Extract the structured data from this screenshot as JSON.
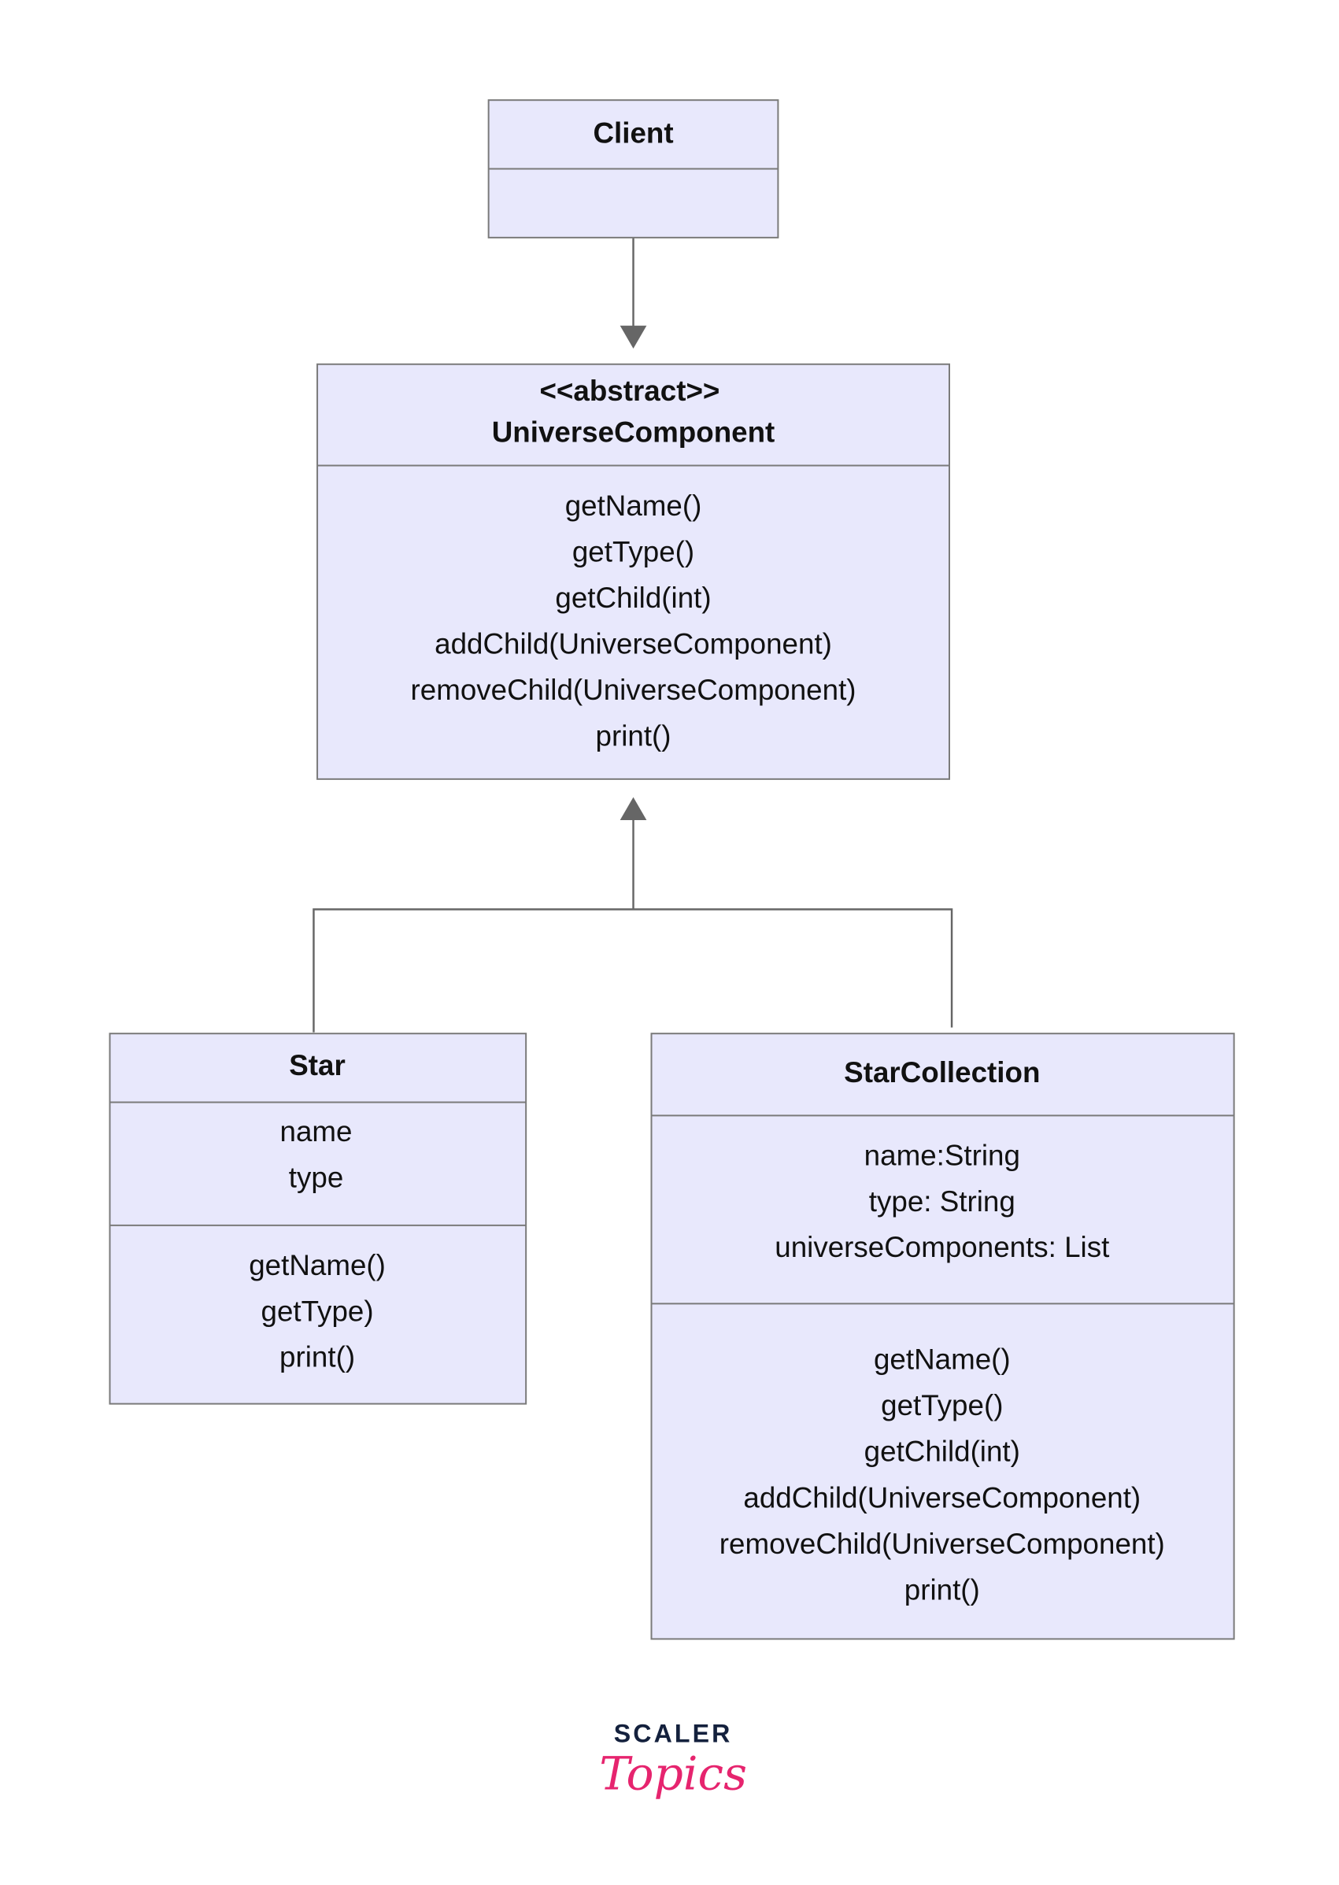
{
  "colors": {
    "box_fill": "#e8e8fc",
    "box_border": "#7a7a7a",
    "edge": "#666666",
    "logo_dark": "#14213d",
    "logo_pink": "#e6246e"
  },
  "client": {
    "title": "Client"
  },
  "universe_component": {
    "stereotype": "<<abstract>>",
    "title": "UniverseComponent",
    "methods": [
      "getName()",
      "getType()",
      "getChild(int)",
      "addChild(UniverseComponent)",
      "removeChild(UniverseComponent)",
      "print()"
    ]
  },
  "star": {
    "title": "Star",
    "attributes": [
      "name",
      "type"
    ],
    "methods": [
      "getName()",
      "getType)",
      "print()"
    ]
  },
  "star_collection": {
    "title": "StarCollection",
    "attributes": [
      "name:String",
      "type: String",
      "universeComponents: List"
    ],
    "methods": [
      "getName()",
      "getType()",
      "getChild(int)",
      "addChild(UniverseComponent)",
      "removeChild(UniverseComponent)",
      "print()"
    ]
  },
  "logo": {
    "line1": "SCALER",
    "line2": "Topics"
  }
}
